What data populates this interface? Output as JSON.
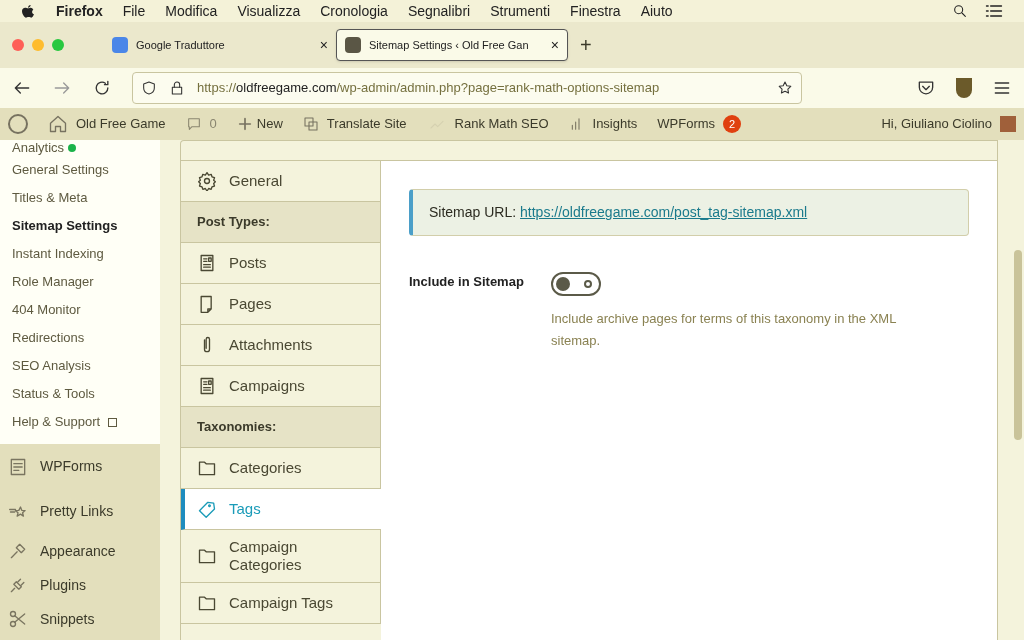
{
  "menubar": {
    "app": "Firefox",
    "items": [
      "File",
      "Modifica",
      "Visualizza",
      "Cronologia",
      "Segnalibri",
      "Strumenti",
      "Finestra",
      "Aiuto"
    ]
  },
  "tabs": [
    {
      "title": "Google Traduttore",
      "selected": false,
      "kind": "translate",
      "close": "×"
    },
    {
      "title": "Sitemap Settings ‹ Old Free Gan",
      "selected": true,
      "kind": "site",
      "close": "×"
    }
  ],
  "new_tab": "+",
  "address": {
    "scheme": "https://",
    "domain": "oldfreegame.com",
    "path": "/wp-admin/admin.php?page=rank-math-options-sitemap"
  },
  "admin_bar": {
    "site": "Old Free Game",
    "comments": "0",
    "new": "New",
    "translate": "Translate Site",
    "rankmath": "Rank Math SEO",
    "insights": "Insights",
    "wpforms": "WPForms",
    "wpforms_count": "2",
    "greeting": "Hi, Giuliano Ciolino"
  },
  "submenu": [
    {
      "label": "Analytics",
      "selected": false,
      "status_dot": true
    },
    {
      "label": "General Settings",
      "selected": false
    },
    {
      "label": "Titles & Meta",
      "selected": false
    },
    {
      "label": "Sitemap Settings",
      "selected": true
    },
    {
      "label": "Instant Indexing",
      "selected": false
    },
    {
      "label": "Role Manager",
      "selected": false
    },
    {
      "label": "404 Monitor",
      "selected": false
    },
    {
      "label": "Redirections",
      "selected": false
    },
    {
      "label": "SEO Analysis",
      "selected": false
    },
    {
      "label": "Status & Tools",
      "selected": false
    },
    {
      "label": "Help & Support",
      "selected": false,
      "external": true
    }
  ],
  "menu": [
    {
      "label": "WPForms",
      "kind": "forms"
    },
    {
      "label": "Pretty Links",
      "kind": "star"
    },
    {
      "label": "Appearance",
      "kind": "brush"
    },
    {
      "label": "Plugins",
      "kind": "plug"
    },
    {
      "label": "Snippets",
      "kind": "scissors"
    }
  ],
  "settings_nav": [
    {
      "kind": "gear",
      "label": "General",
      "selected": false
    },
    {
      "kind": "heading",
      "label": "Post Types:"
    },
    {
      "kind": "doc",
      "label": "Posts",
      "selected": false
    },
    {
      "kind": "page",
      "label": "Pages",
      "selected": false
    },
    {
      "kind": "clip",
      "label": "Attachments",
      "selected": false
    },
    {
      "kind": "doc",
      "label": "Campaigns",
      "selected": false
    },
    {
      "kind": "heading",
      "label": "Taxonomies:"
    },
    {
      "kind": "folder",
      "label": "Categories",
      "selected": false
    },
    {
      "kind": "tag",
      "label": "Tags",
      "selected": true
    },
    {
      "kind": "folder",
      "label": "Campaign Categories",
      "selected": false
    },
    {
      "kind": "folder",
      "label": "Campaign Tags",
      "selected": false
    }
  ],
  "sitemap_url": {
    "label": "Sitemap URL:",
    "link": "https://oldfreegame.com/post_tag-sitemap.xml"
  },
  "include": {
    "label": "Include in Sitemap",
    "on": false,
    "description": "Include archive pages for terms of this taxonomy in the XML sitemap."
  }
}
